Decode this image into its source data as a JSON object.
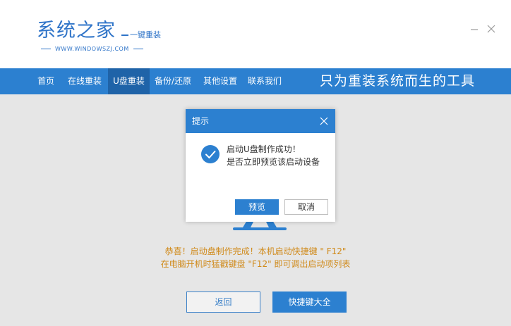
{
  "header": {
    "logo_title": "系统之家",
    "logo_subtitle": "一键重装",
    "logo_url": "WWW.WINDOWSZJ.COM",
    "minimize_icon": "minimize-icon",
    "close_icon": "close-icon"
  },
  "nav": {
    "items": [
      {
        "label": "首页"
      },
      {
        "label": "在线重装"
      },
      {
        "label": "U盘重装"
      },
      {
        "label": "备份/还原"
      },
      {
        "label": "其他设置"
      },
      {
        "label": "联系我们"
      }
    ],
    "active": "U盘重装",
    "slogan": "只为重装系统而生的工具"
  },
  "dialog": {
    "title": "提示",
    "message_line1": "启动U盘制作成功！",
    "message_line2": "是否立即预览该启动设备",
    "preview_label": "预览",
    "cancel_label": "取消",
    "icon": "check-circle-icon"
  },
  "main": {
    "notice_line1": "恭喜！启动盘制作完成！本机启动快捷键 \" F12\"",
    "notice_line2": "在电脑开机时猛戳键盘 \"F12\" 即可调出启动项列表",
    "back_label": "返回",
    "hotkeys_label": "快捷键大全"
  },
  "colors": {
    "brand_blue": "#2c80d0",
    "nav_active": "#1f63a8",
    "notice_orange": "#d08a1a",
    "overlay_gray": "#e6e6e6"
  }
}
